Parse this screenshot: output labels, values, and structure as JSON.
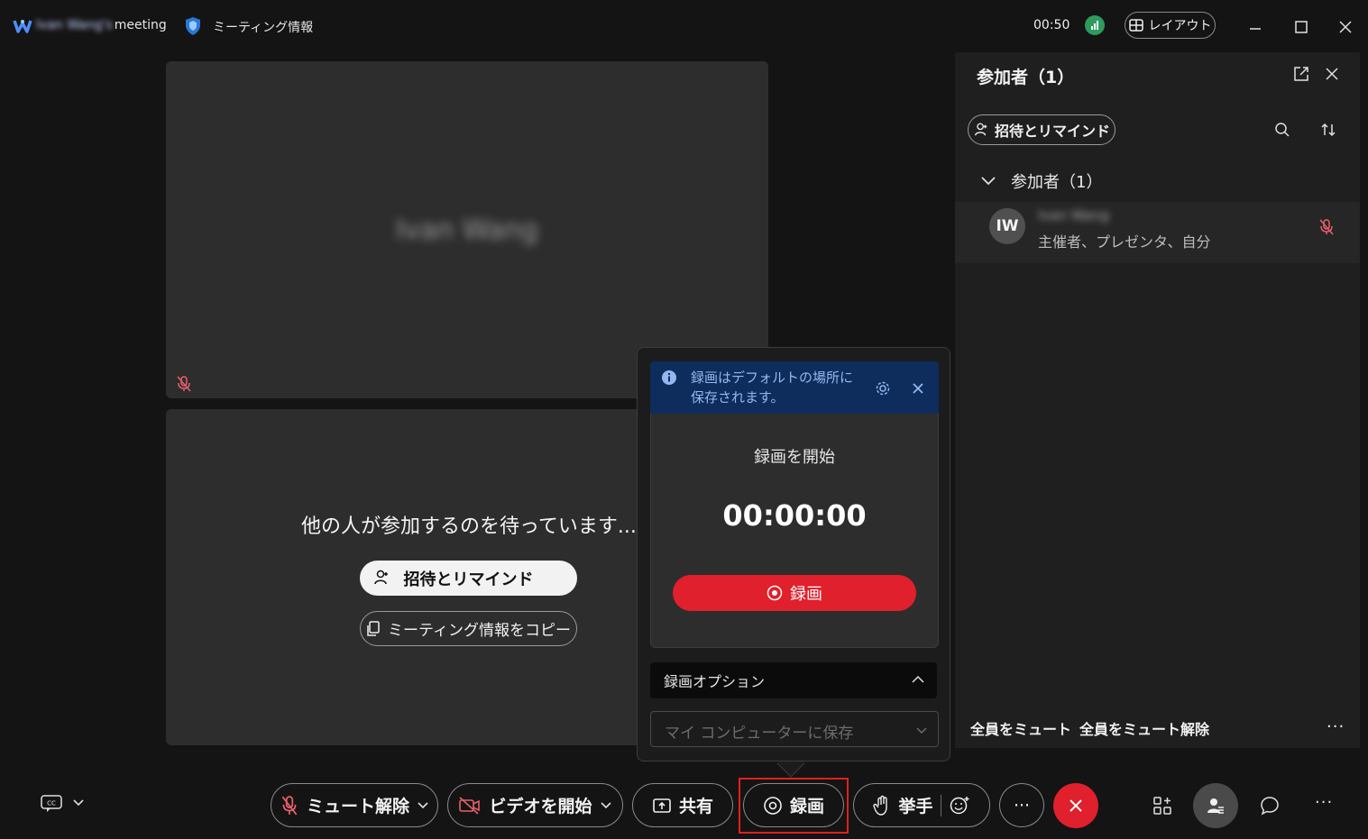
{
  "titlebar": {
    "meeting_name_blurred": "Ivan Wang's",
    "meeting_suffix": " meeting",
    "meeting_info": "ミーティング情報",
    "timer": "00:50",
    "layout_label": "レイアウト"
  },
  "stage": {
    "top_tile_name": "Ivan Wang",
    "waiting_text": "他の人が参加するのを待っています....",
    "invite_label": "招待とリマインド",
    "copy_label": "ミーティング情報をコピー"
  },
  "panel": {
    "title": "参加者（1）",
    "invite_label": "招待とリマインド",
    "group_label": "参加者（1）",
    "participant": {
      "initials": "IW",
      "name": "Ivan Wang",
      "roles": "主催者、プレゼンタ、自分"
    },
    "mute_all": "全員をミュート",
    "unmute_all": "全員をミュート解除",
    "more": "···"
  },
  "record_popup": {
    "banner_text": "録画はデフォルトの場所に保存されます。",
    "start_label": "録画を開始",
    "time": "00:00:00",
    "record_button": "録画",
    "options_label": "録画オプション",
    "save_location": "マイ コンピューターに保存"
  },
  "toolbar": {
    "unmute": "ミュート解除",
    "video": "ビデオを開始",
    "share": "共有",
    "record": "録画",
    "raise_hand": "挙手",
    "more": "···",
    "right_more": "···"
  },
  "colors": {
    "accent_red": "#e0202c",
    "banner_blue": "#0e2d5c",
    "signal_green": "#2e9a5c"
  }
}
